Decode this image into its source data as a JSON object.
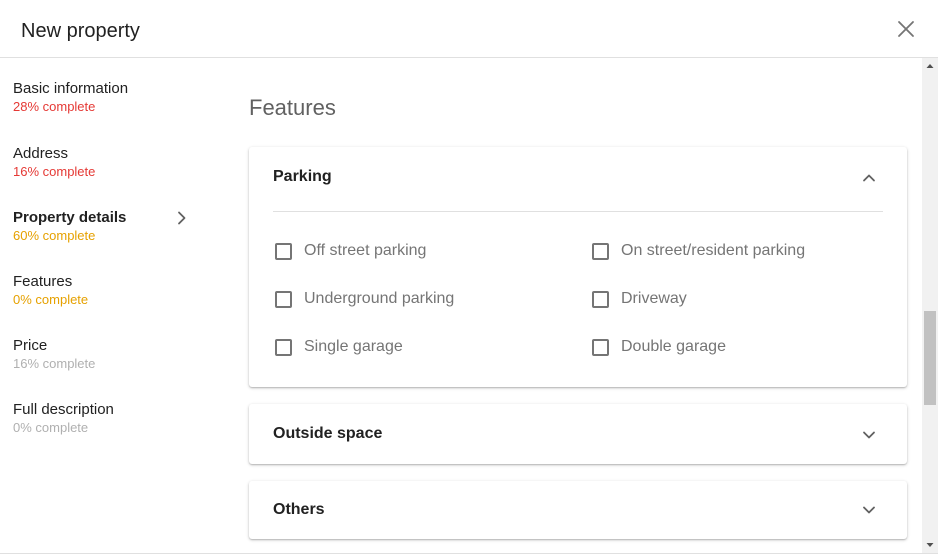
{
  "header": {
    "title": "New property"
  },
  "sidebar": {
    "items": [
      {
        "label": "Basic information",
        "progress": "28% complete",
        "progress_color": "#e53935"
      },
      {
        "label": "Address",
        "progress": "16% complete",
        "progress_color": "#e53935"
      },
      {
        "label": "Property details",
        "progress": "60% complete",
        "progress_color": "#e6a100"
      },
      {
        "label": "Features",
        "progress": "0% complete",
        "progress_color": "#e6a100"
      },
      {
        "label": "Price",
        "progress": "16% complete",
        "progress_color": "#b0b0b0"
      },
      {
        "label": "Full description",
        "progress": "0% complete",
        "progress_color": "#b0b0b0"
      }
    ]
  },
  "main": {
    "title": "Features",
    "panels": [
      {
        "title": "Parking",
        "expanded": true,
        "options": [
          "Off street parking",
          "On street/resident parking",
          "Underground parking",
          "Driveway",
          "Single garage",
          "Double garage"
        ]
      },
      {
        "title": "Outside space",
        "expanded": false
      },
      {
        "title": "Others",
        "expanded": false
      }
    ]
  },
  "icons": {
    "close": "close-icon",
    "active_indicator": "chevron-right-icon",
    "collapse": "chevron-up-icon",
    "expand": "chevron-down-icon"
  }
}
